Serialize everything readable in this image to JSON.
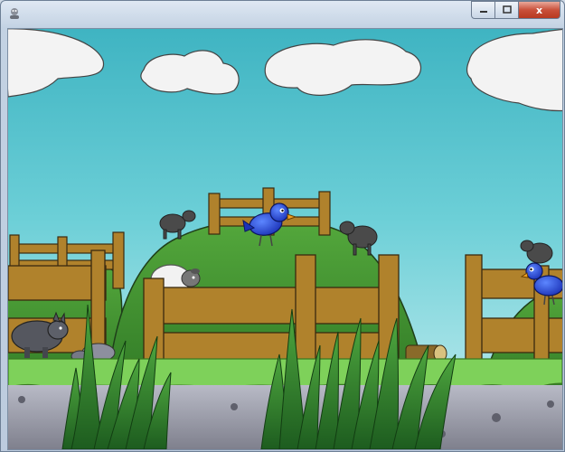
{
  "window": {
    "icon": "game-app-icon",
    "controls": {
      "minimize_icon": "minimize-icon",
      "maximize_icon": "maximize-icon",
      "close_label": "x"
    }
  },
  "scene": {
    "icons": [
      "cloud-icon",
      "bird-icon",
      "sheep-icon",
      "wolf-icon",
      "fence-icon",
      "grass-icon",
      "rock-icon",
      "log-icon"
    ],
    "colors": {
      "sky_top": "#3fb4c2",
      "sky_bottom": "#c2eaee",
      "hill": "#3f8f2f",
      "fence": "#b0822c",
      "grass": "#7ed15a",
      "stone": "#8d8f9e",
      "bird": "#2244cc",
      "sheep_white": "#f2f2f2"
    }
  }
}
